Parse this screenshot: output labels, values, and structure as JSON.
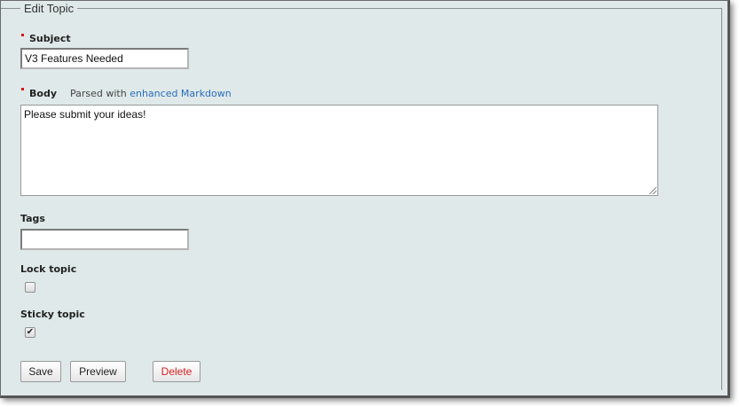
{
  "form": {
    "legend": "Edit Topic",
    "subject": {
      "label": "Subject",
      "value": "V3 Features Needed",
      "required": true
    },
    "body": {
      "label": "Body",
      "hint_prefix": "Parsed with",
      "hint_link": "enhanced Markdown",
      "value": "Please submit your ideas!",
      "required": true
    },
    "tags": {
      "label": "Tags",
      "value": ""
    },
    "lock_topic": {
      "label": "Lock topic",
      "checked": false
    },
    "sticky_topic": {
      "label": "Sticky topic",
      "checked": true
    },
    "buttons": {
      "save": "Save",
      "preview": "Preview",
      "delete": "Delete"
    }
  },
  "colors": {
    "background": "#dfe9e9",
    "required_marker": "#dd1111",
    "link": "#2a6db9",
    "delete_text": "#d21f1f"
  }
}
